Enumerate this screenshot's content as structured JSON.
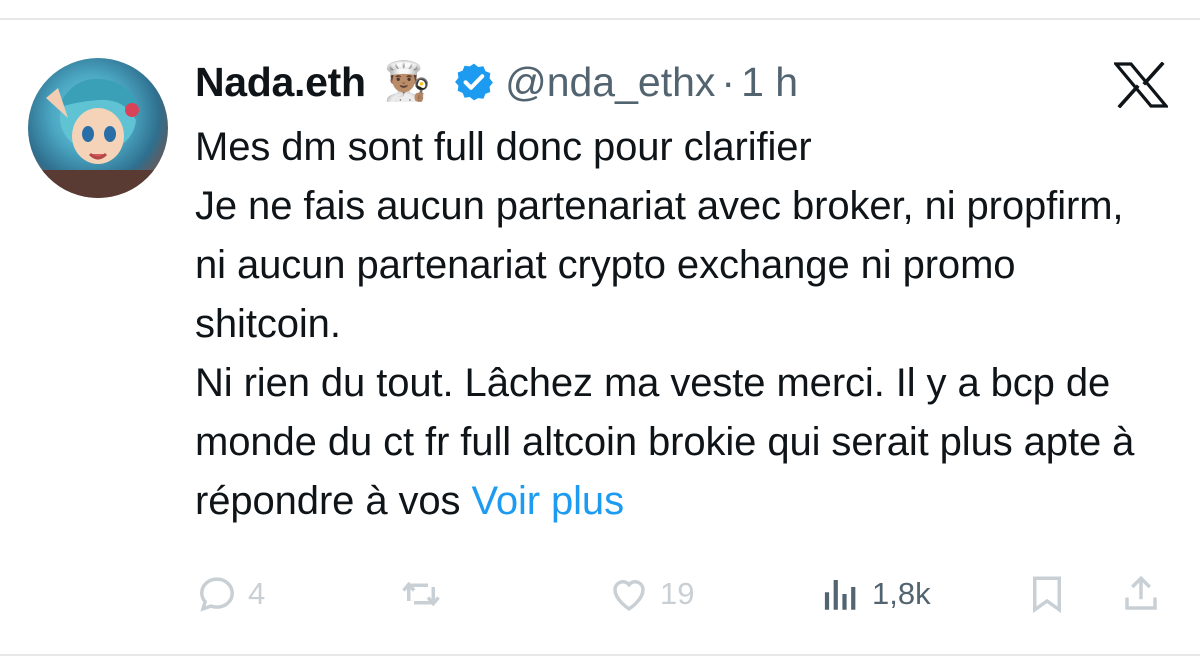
{
  "tweet": {
    "display_name": "Nada.eth",
    "emoji": "👨🏽‍🍳",
    "handle": "@nda_ethx",
    "separator": "·",
    "time": "1 h",
    "text": "Mes dm sont full donc pour clarifier\nJe ne fais aucun partenariat avec broker, ni propfirm, ni aucun partenariat crypto exchange ni promo shitcoin.\nNi rien du tout. Lâchez ma veste merci. Il y a bcp de monde du ct fr full altcoin brokie qui serait plus apte à répondre à vos ",
    "see_more": "Voir plus"
  },
  "actions": {
    "replies": "4",
    "reposts": "",
    "likes": "19",
    "views": "1,8k"
  },
  "icons": {
    "verified": "verified-badge-icon",
    "logo": "x-logo-icon",
    "reply": "reply-icon",
    "repost": "repost-icon",
    "like": "heart-icon",
    "views": "views-icon",
    "bookmark": "bookmark-icon",
    "share": "share-icon"
  },
  "colors": {
    "link": "#1d9bf0",
    "verified": "#1d9bf0",
    "muted": "#536471",
    "action_faded": "#c9d0d5"
  }
}
